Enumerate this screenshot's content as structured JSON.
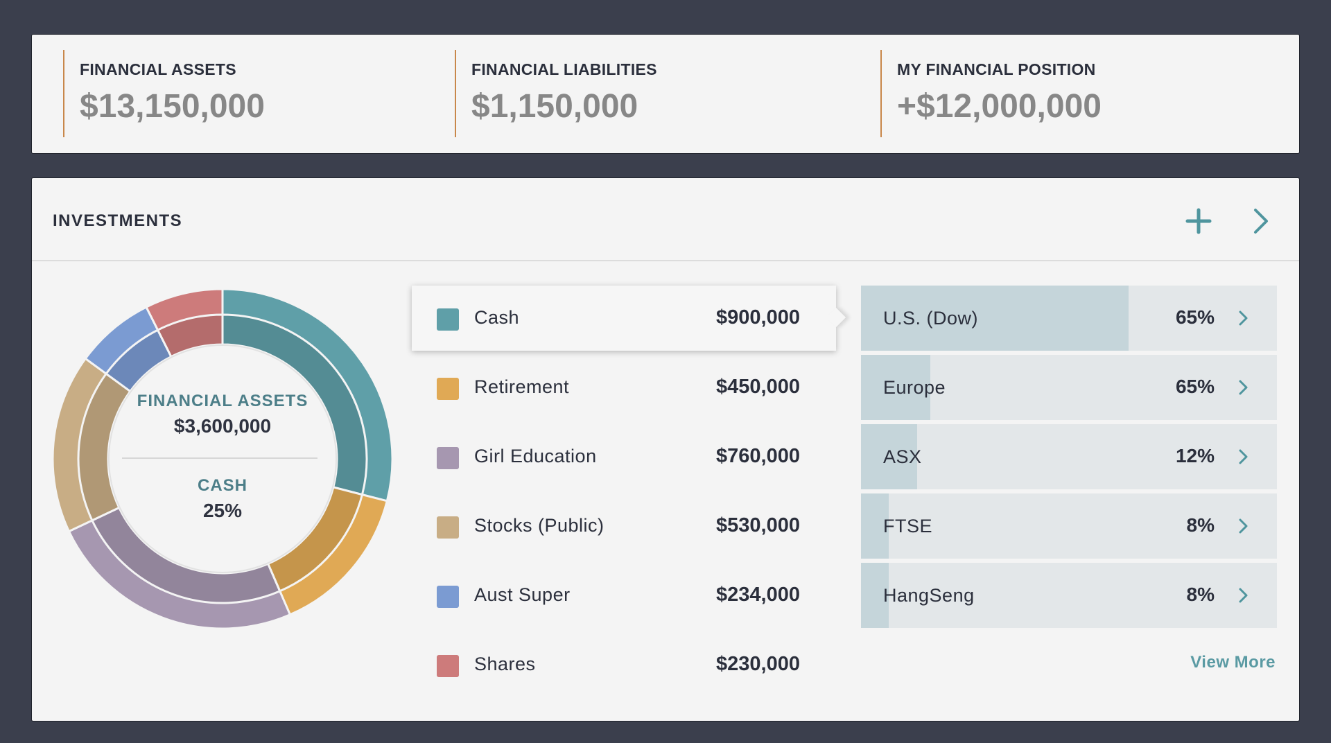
{
  "summary": {
    "assets_label": "FINANCIAL ASSETS",
    "assets_value": "$13,150,000",
    "liabilities_label": "FINANCIAL LIABILITIES",
    "liabilities_value": "$1,150,000",
    "position_label": "MY FINANCIAL POSITION",
    "position_value": "+$12,000,000",
    "accent_color": "#c8874a"
  },
  "investments": {
    "title": "INVESTMENTS",
    "add_icon": "plus-icon",
    "next_icon": "chevron-right-icon",
    "center": {
      "label": "FINANCIAL ASSETS",
      "value": "$3,600,000",
      "selected_label": "CASH",
      "selected_value": "25%"
    },
    "categories": [
      {
        "label": "Cash",
        "value": "$900,000",
        "amount": 900000,
        "color": "#5f9fa8",
        "selected": true
      },
      {
        "label": "Retirement",
        "value": "$450,000",
        "amount": 450000,
        "color": "#e0a955",
        "selected": false
      },
      {
        "label": "Girl Education",
        "value": "$760,000",
        "amount": 760000,
        "color": "#a697b0",
        "selected": false
      },
      {
        "label": "Stocks (Public)",
        "value": "$530,000",
        "amount": 530000,
        "color": "#c8ad85",
        "selected": false
      },
      {
        "label": "Aust Super",
        "value": "$234,000",
        "amount": 234000,
        "color": "#7b9bd2",
        "selected": false
      },
      {
        "label": "Shares",
        "value": "$230,000",
        "amount": 230000,
        "color": "#cd7b7b",
        "selected": false
      }
    ],
    "markets": [
      {
        "label": "U.S. (Dow)",
        "pct": "65%",
        "fill": 0.643
      },
      {
        "label": "Europe",
        "pct": "65%",
        "fill": 0.167
      },
      {
        "label": "ASX",
        "pct": "12%",
        "fill": 0.135
      },
      {
        "label": "FTSE",
        "pct": "8%",
        "fill": 0.067
      },
      {
        "label": "HangSeng",
        "pct": "8%",
        "fill": 0.067
      }
    ],
    "view_more": "View  More"
  }
}
